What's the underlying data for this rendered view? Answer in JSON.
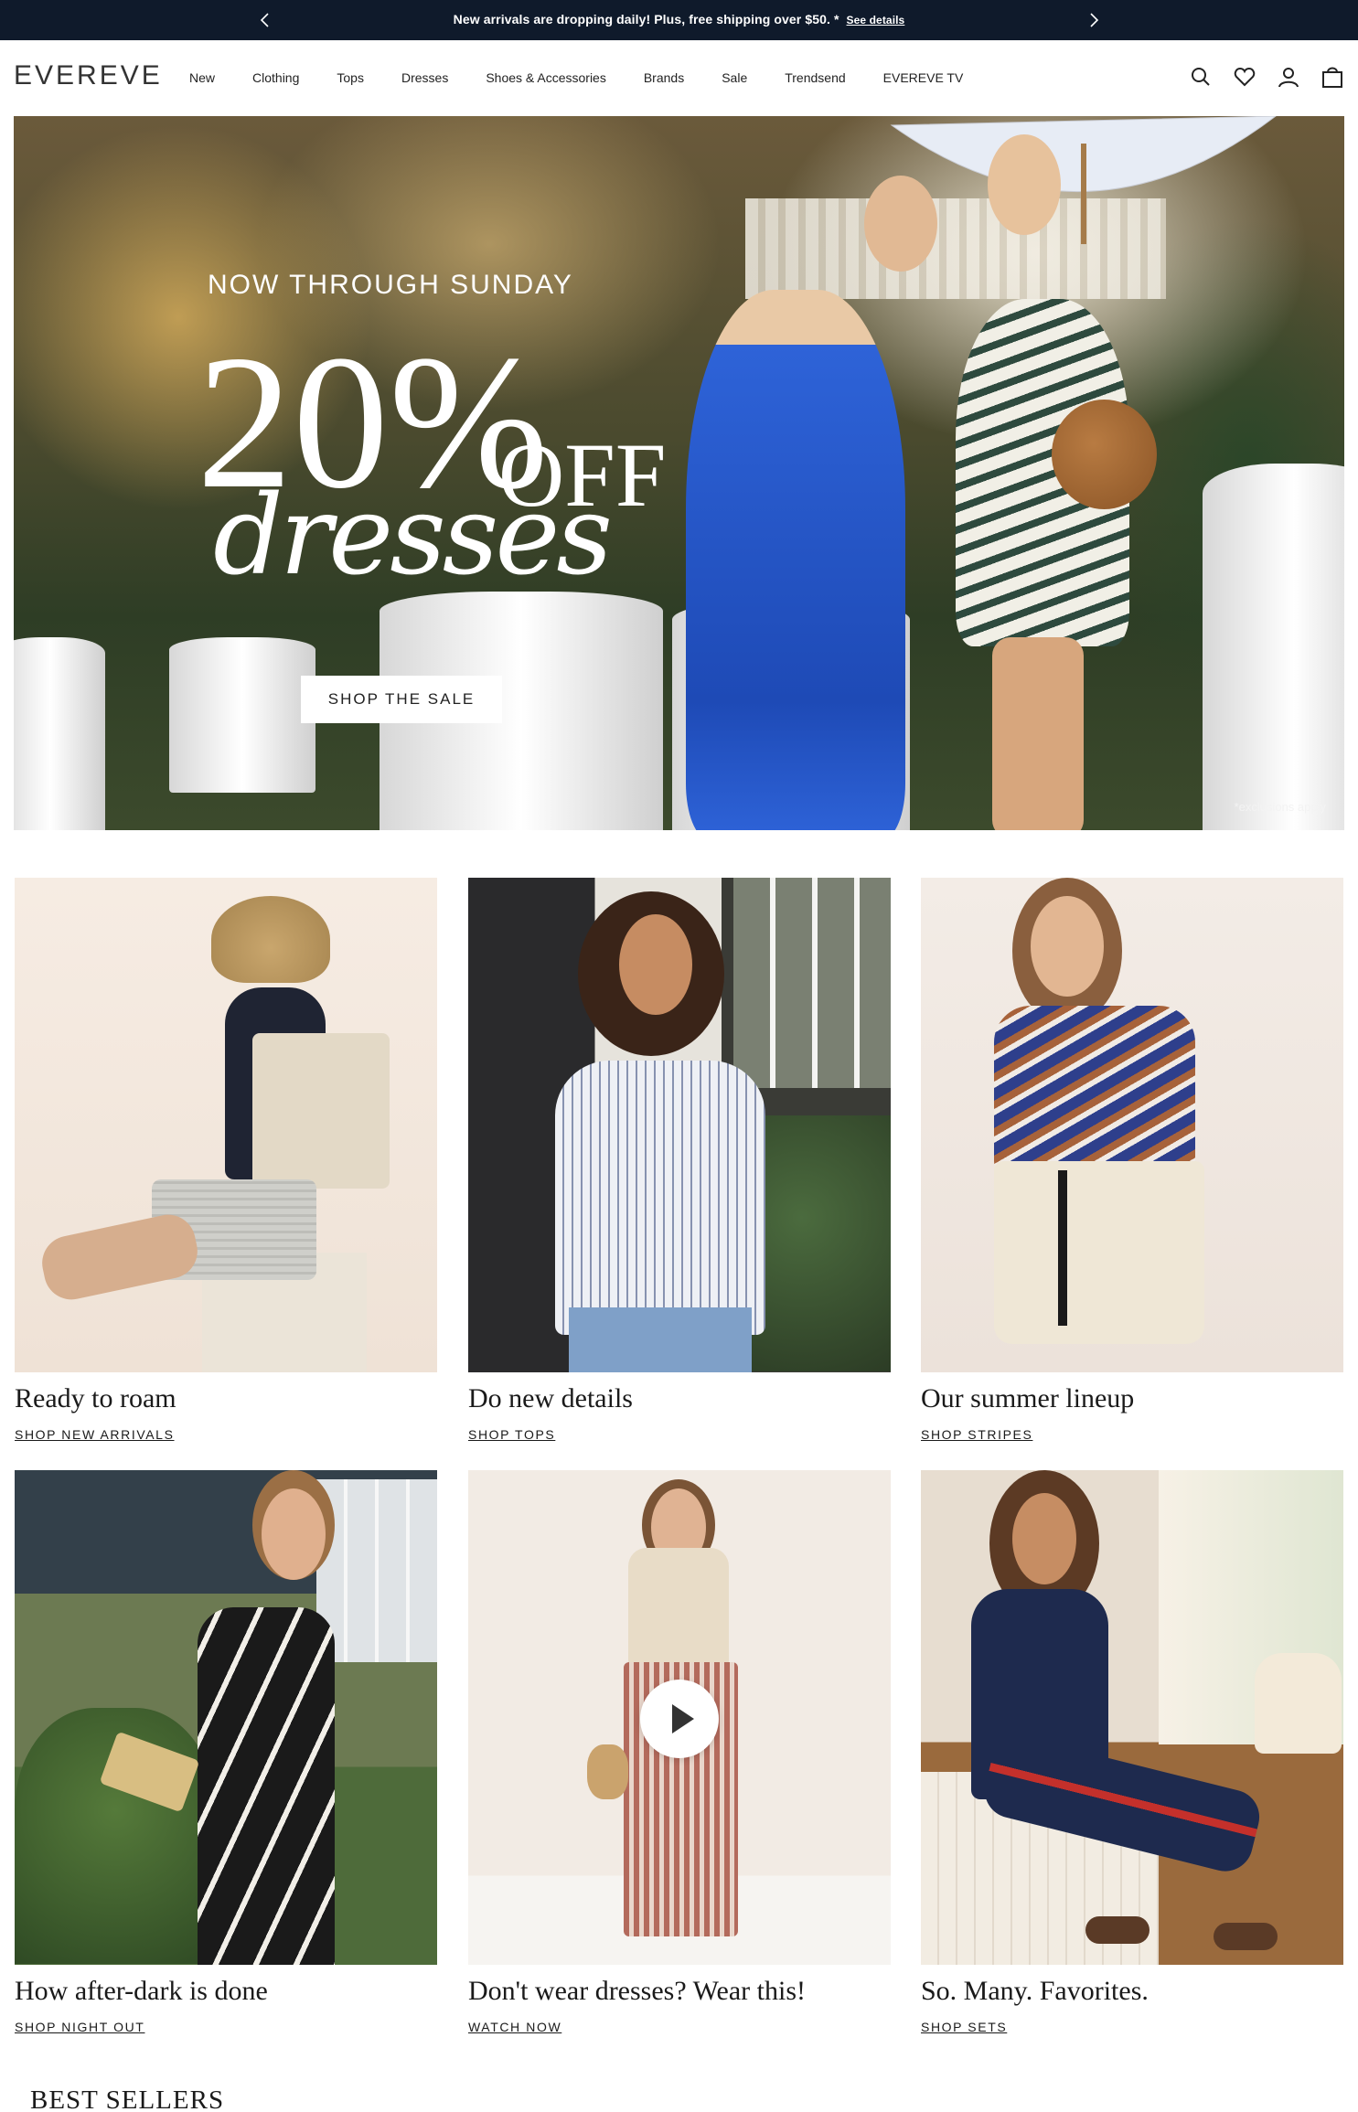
{
  "announcement": {
    "message": "New arrivals are dropping daily! Plus, free shipping over $50. *",
    "link_label": "See details"
  },
  "header": {
    "logo": "EVEREVE",
    "nav": [
      "New",
      "Clothing",
      "Tops",
      "Dresses",
      "Shoes & Accessories",
      "Brands",
      "Sale",
      "Trendsend",
      "EVEREVE TV"
    ],
    "icons": [
      "search-icon",
      "heart-icon",
      "account-icon",
      "bag-icon"
    ]
  },
  "hero": {
    "eyebrow": "NOW THROUGH SUNDAY",
    "headline_number": "20%",
    "headline_off": "OFF",
    "headline_script": "dresses",
    "cta_label": "SHOP THE SALE",
    "fine_print": "*exclusions apply"
  },
  "tiles": [
    {
      "title": "Ready to roam",
      "link": "SHOP NEW ARRIVALS"
    },
    {
      "title": "Do new details",
      "link": "SHOP TOPS"
    },
    {
      "title": "Our summer lineup",
      "link": "SHOP STRIPES"
    },
    {
      "title": "How after-dark is done",
      "link": "SHOP NIGHT OUT"
    },
    {
      "title": "Don't wear dresses? Wear this!",
      "link": "WATCH NOW"
    },
    {
      "title": "So. Many. Favorites.",
      "link": "SHOP SETS"
    }
  ],
  "section_heading": "BEST SELLERS",
  "colors": {
    "announcement_bg": "#0f1a2b",
    "text": "#1a1a1a",
    "white": "#ffffff"
  }
}
